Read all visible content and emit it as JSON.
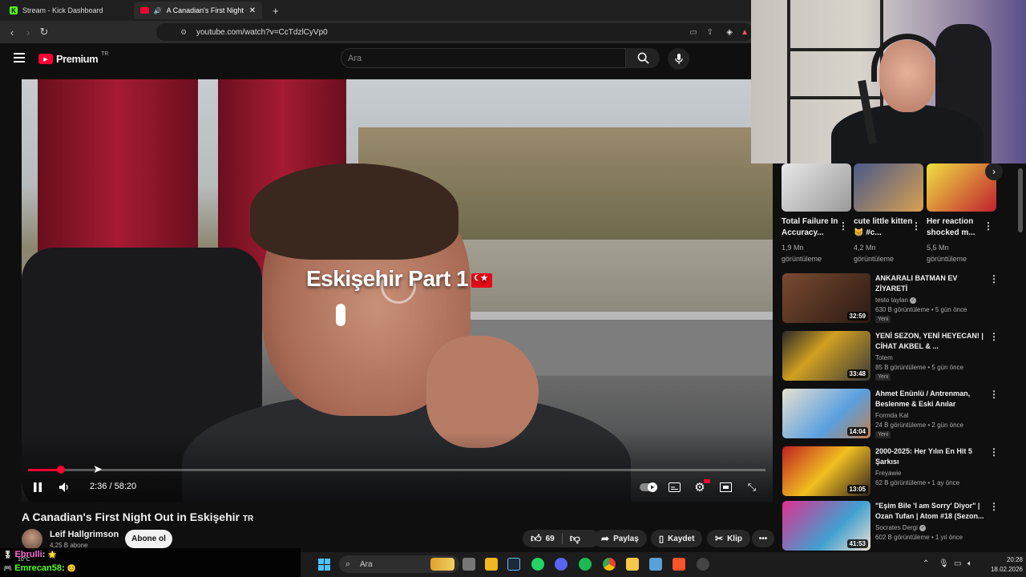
{
  "browser": {
    "tabs": [
      {
        "label": "Stream - Kick Dashboard"
      },
      {
        "label": "A Canadian's First Night Out"
      }
    ],
    "new_tab": "+",
    "url": "youtube.com/watch?v=CcTdzlCyVp0"
  },
  "youtube": {
    "logo_text": "Premium",
    "logo_region": "TR",
    "search_placeholder": "Ara"
  },
  "player": {
    "overlay_title": "Eskişehir Part 1",
    "timecode": "2:36 / 58:20",
    "progress_fraction": 0.045
  },
  "video": {
    "title": "A Canadian's First Night Out in Eskişehir",
    "title_tag": "TR",
    "channel": "Leif Hallgrimson",
    "subscribers": "4,25 B abone",
    "subscribe_label": "Abone ol",
    "likes": "69",
    "share_label": "Paylaş",
    "save_label": "Kaydet",
    "clip_label": "Klip"
  },
  "shorts": [
    {
      "title": "Total Failure In Accuracy...",
      "views": "1,9 Mn görüntüleme"
    },
    {
      "title": "cute little kitten😸 #c...",
      "views": "4,2 Mn görüntüleme"
    },
    {
      "title": "Her reaction shocked m...",
      "views": "5,5 Mn görüntüleme"
    }
  ],
  "recommendations": [
    {
      "title": "ANKARALI BATMAN EV ZİYARETİ",
      "channel": "testo taylan",
      "verified": true,
      "meta": "630 B görüntüleme • 5 gün önce",
      "badge": "Yeni",
      "duration": "32:59",
      "color": "#5a3a2a"
    },
    {
      "title": "YENİ SEZON, YENİ HEYECAN! | CİHAT AKBEL & ...",
      "channel": "Totem",
      "verified": false,
      "meta": "85 B görüntüleme • 5 gün önce",
      "badge": "Yeni",
      "duration": "33:48",
      "color": "#2a3a2a"
    },
    {
      "title": "Ahmet Enünlü / Antrenman, Beslenme & Eski Anılar",
      "channel": "Formda Kal",
      "verified": false,
      "meta": "24 B görüntüleme • 2 gün önce",
      "badge": "Yeni",
      "duration": "14:04",
      "color": "#2a5a8a"
    },
    {
      "title": "2000-2025: Her Yılın En Hit 5 Şarkısı",
      "channel": "Freyawie",
      "verified": false,
      "meta": "62 B görüntüleme • 1 ay önce",
      "badge": "",
      "duration": "13:05",
      "color": "#6a2a2a"
    },
    {
      "title": "\"Eşim Bile 'I am Sorry' Diyor\" | Ozan Tufan | Atom #18 (Sezon...",
      "channel": "Socrates Dergi",
      "verified": true,
      "meta": "602 B görüntüleme • 1 yıl önce",
      "badge": "",
      "duration": "41:53",
      "color": "#8a2a6a"
    }
  ],
  "chat": [
    {
      "user": "Ebrulli",
      "text": ":",
      "color": "#ff6ad5"
    },
    {
      "user": "Emrecan58",
      "text": ":",
      "color": "#53fc18"
    }
  ],
  "chat_weather": "10°C",
  "taskbar": {
    "search_placeholder": "Ara",
    "time": "20:28",
    "date": "18.02.2026"
  }
}
